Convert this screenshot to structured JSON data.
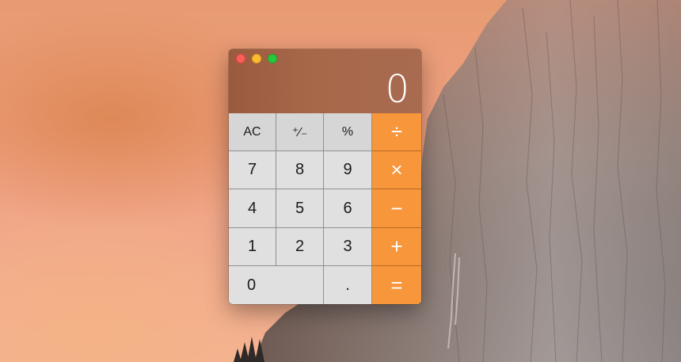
{
  "window": {
    "app": "Calculator",
    "traffic_lights": [
      "close",
      "minimize",
      "zoom"
    ],
    "display_value": "0"
  },
  "keys": {
    "ac": "AC",
    "plusminus": "⁺∕₋",
    "percent": "%",
    "divide": "÷",
    "seven": "7",
    "eight": "8",
    "nine": "9",
    "multiply": "×",
    "four": "4",
    "five": "5",
    "six": "6",
    "minus": "−",
    "one": "1",
    "two": "2",
    "three": "3",
    "plus": "+",
    "zero": "0",
    "decimal": ".",
    "equals": "="
  },
  "colors": {
    "operator_key": "#f7963a",
    "function_key": "#d6d6d6",
    "number_key": "#e0e0e0",
    "display_bg": "#a3644a",
    "close_light": "#fc5f57",
    "minimize_light": "#fdbc2e",
    "zoom_light": "#28c840"
  }
}
